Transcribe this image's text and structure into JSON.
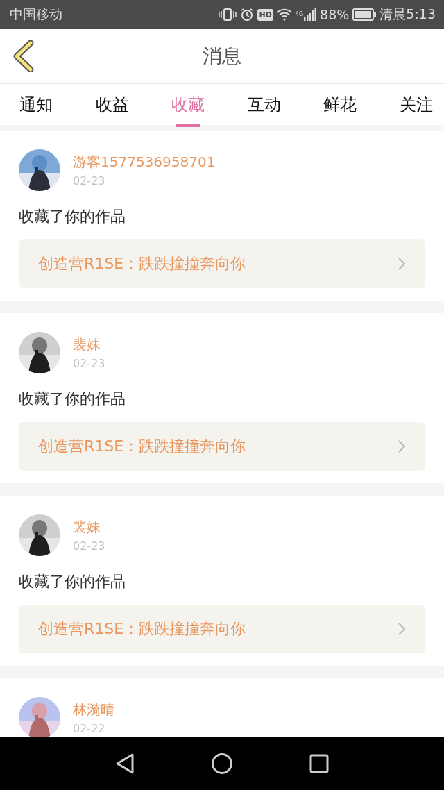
{
  "status_bar": {
    "carrier": "中国移动",
    "hd": "HD",
    "network": "4G",
    "battery": "88%",
    "time": "清晨5:13"
  },
  "header": {
    "title": "消息"
  },
  "tabs": [
    {
      "label": "通知",
      "selected": false
    },
    {
      "label": "收益",
      "selected": false
    },
    {
      "label": "收藏",
      "selected": true
    },
    {
      "label": "互动",
      "selected": false
    },
    {
      "label": "鲜花",
      "selected": false
    },
    {
      "label": "关注",
      "selected": false
    }
  ],
  "notifications": [
    {
      "user": "游客1577536958701",
      "date": "02-23",
      "message": "收藏了你的作品",
      "work": "创造营R1SE：跌跌撞撞奔向你"
    },
    {
      "user": "裴妹",
      "date": "02-23",
      "message": "收藏了你的作品",
      "work": "创造营R1SE：跌跌撞撞奔向你"
    },
    {
      "user": "裴妹",
      "date": "02-23",
      "message": "收藏了你的作品",
      "work": "创造营R1SE：跌跌撞撞奔向你"
    },
    {
      "user": "林漪晴",
      "date": "02-22"
    }
  ]
}
